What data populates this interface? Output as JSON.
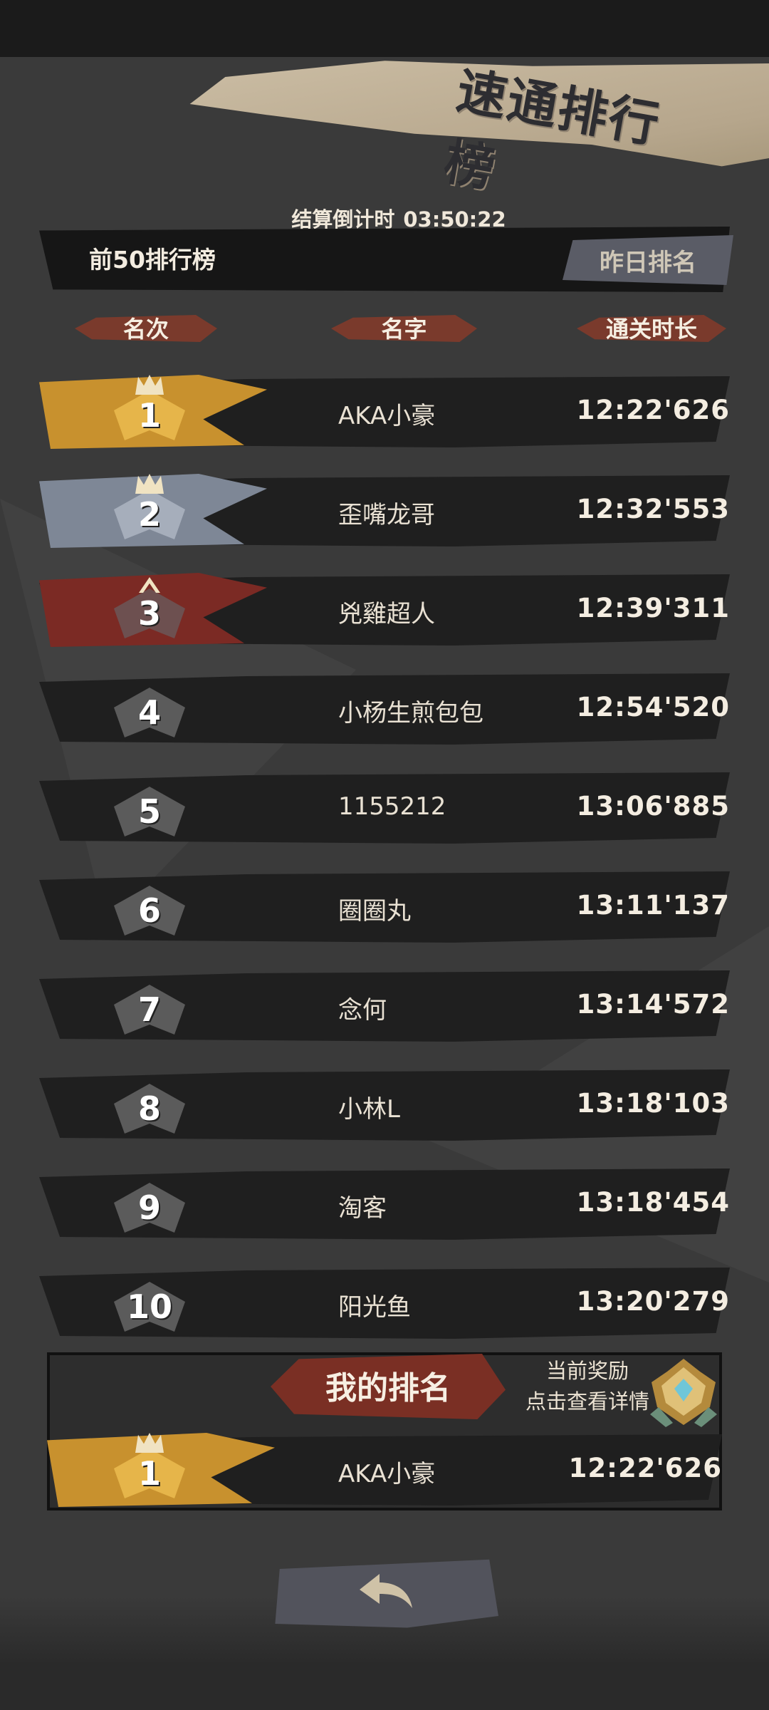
{
  "header": {
    "title": "速通排行榜",
    "countdown_label": "结算倒计时",
    "countdown_value": "03:50:22"
  },
  "tabs": {
    "top50": "前50排行榜",
    "yesterday": "昨日排名"
  },
  "columns": {
    "rank": "名次",
    "name": "名字",
    "time": "通关时长"
  },
  "leaderboard": [
    {
      "rank": "1",
      "name": "AKA小豪",
      "time": "12:22'626"
    },
    {
      "rank": "2",
      "name": "歪嘴龙哥",
      "time": "12:32'553"
    },
    {
      "rank": "3",
      "name": "兇雞超人",
      "time": "12:39'311"
    },
    {
      "rank": "4",
      "name": "小杨生煎包包",
      "time": "12:54'520"
    },
    {
      "rank": "5",
      "name": "1155212",
      "time": "13:06'885"
    },
    {
      "rank": "6",
      "name": "圈圈丸",
      "time": "13:11'137"
    },
    {
      "rank": "7",
      "name": "念何",
      "time": "13:14'572"
    },
    {
      "rank": "8",
      "name": "小林L",
      "time": "13:18'103"
    },
    {
      "rank": "9",
      "name": "淘客",
      "time": "13:18'454"
    },
    {
      "rank": "10",
      "name": "阳光鱼",
      "time": "13:20'279"
    }
  ],
  "my_rank": {
    "title": "我的排名",
    "reward_line1": "当前奖励",
    "reward_line2": "点击查看详情",
    "rank": "1",
    "name": "AKA小豪",
    "time": "12:22'626"
  },
  "colors": {
    "gold": "#d9a53a",
    "silver": "#8f98a8",
    "bronze": "#8a3028",
    "row_bg": "#1f1f1f",
    "accent_red": "#7a3a2c"
  },
  "icons": {
    "back": "back-arrow-icon",
    "reward": "reward-medal-icon"
  }
}
